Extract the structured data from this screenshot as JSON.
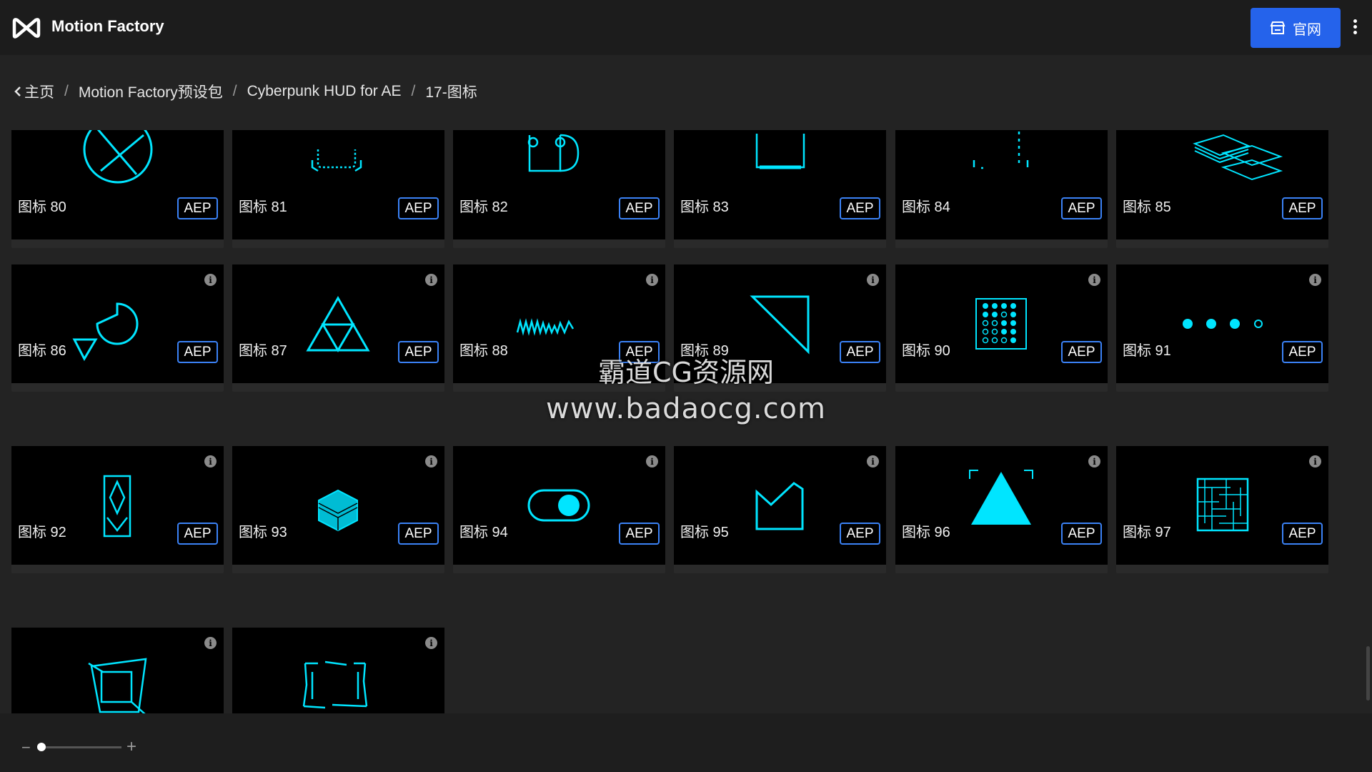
{
  "app": {
    "title": "Motion Factory"
  },
  "header": {
    "site_button_label": "官网"
  },
  "breadcrumb": [
    "主页",
    "Motion Factory预设包",
    "Cyberpunk HUD for AE",
    "17-图标"
  ],
  "colors": {
    "accent": "#2563eb",
    "glow": "#00e5ff",
    "background": "#232323",
    "thumb": "#000000"
  },
  "items": [
    {
      "label": "图标 80",
      "badge": "AEP",
      "icon": "circle-cross-glyph"
    },
    {
      "label": "图标 81",
      "badge": "AEP",
      "icon": "dashed-frame-glyph"
    },
    {
      "label": "图标 82",
      "badge": "AEP",
      "icon": "puzzle-glyph"
    },
    {
      "label": "图标 83",
      "badge": "AEP",
      "icon": "bracket-bar-glyph"
    },
    {
      "label": "图标 84",
      "badge": "AEP",
      "icon": "dotted-line-glyph"
    },
    {
      "label": "图标 85",
      "badge": "AEP",
      "icon": "stacked-layers-glyph"
    },
    {
      "label": "图标 86",
      "badge": "AEP",
      "icon": "pie-triangle-glyph"
    },
    {
      "label": "图标 87",
      "badge": "AEP",
      "icon": "triforce-glyph"
    },
    {
      "label": "图标 88",
      "badge": "AEP",
      "icon": "waveform-glyph"
    },
    {
      "label": "图标 89",
      "badge": "AEP",
      "icon": "corner-triangle-glyph"
    },
    {
      "label": "图标 90",
      "badge": "AEP",
      "icon": "dot-matrix-glyph"
    },
    {
      "label": "图标 91",
      "badge": "AEP",
      "icon": "loading-dots-glyph"
    },
    {
      "label": "图标 92",
      "badge": "AEP",
      "icon": "diamond-frame-glyph"
    },
    {
      "label": "图标 93",
      "badge": "AEP",
      "icon": "hexagon-stack-glyph"
    },
    {
      "label": "图标 94",
      "badge": "AEP",
      "icon": "toggle-switch-glyph"
    },
    {
      "label": "图标 95",
      "badge": "AEP",
      "icon": "crown-box-glyph"
    },
    {
      "label": "图标 96",
      "badge": "AEP",
      "icon": "filled-triangle-glyph"
    },
    {
      "label": "图标 97",
      "badge": "AEP",
      "icon": "maze-grid-glyph"
    },
    {
      "label": "",
      "badge": "",
      "icon": "rotated-square-glyph"
    },
    {
      "label": "",
      "badge": "",
      "icon": "glitch-frame-glyph"
    }
  ],
  "watermark": {
    "line1": "霸道CG资源网",
    "line2": "www.badaocg.com"
  },
  "zoom": {
    "minus": "−",
    "plus": "+",
    "level": 0.05
  }
}
